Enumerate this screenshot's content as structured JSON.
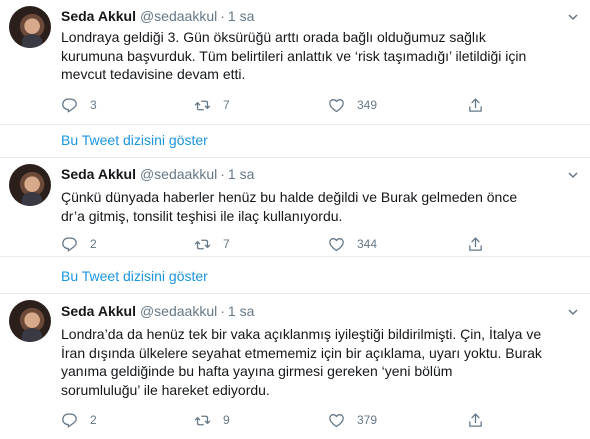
{
  "tweets": [
    {
      "name": "Seda Akkul",
      "handle": "@sedaakkul",
      "separator": "·",
      "time": "1 sa",
      "text": "Londraya geldiği 3. Gün öksürüğü arttı orada bağlı olduğumuz sağlık\nkurumuna başvurduk. Tüm belirtileri anlattık ve ‘risk taşımadığı’  iletildiği için\nmevcut tedavisine devam etti.",
      "replies": "3",
      "retweets": "7",
      "likes": "349",
      "thread_link": "Bu Tweet dizisini göster"
    },
    {
      "name": "Seda Akkul",
      "handle": "@sedaakkul",
      "separator": "·",
      "time": "1 sa",
      "text": "Çünkü dünyada haberler henüz bu halde değildi ve Burak gelmeden önce\ndr’a gitmiş, tonsilit teşhisi ile ilaç kullanıyordu.",
      "replies": "2",
      "retweets": "7",
      "likes": "344",
      "thread_link": "Bu Tweet dizisini göster"
    },
    {
      "name": "Seda Akkul",
      "handle": "@sedaakkul",
      "separator": "·",
      "time": "1 sa",
      "text": "Londra’da da henüz tek bir vaka açıklanmış iyileştiği bildirilmişti. Çin, İtalya ve\nİran dışında ülkelere seyahat etmememiz için bir açıklama, uyarı yoktu. Burak\nyanıma geldiğinde bu hafta yayına girmesi gereken ‘yeni bölüm\nsorumluluğu’ ile hareket ediyordu.",
      "replies": "2",
      "retweets": "9",
      "likes": "379"
    }
  ],
  "icons": {
    "reply": "reply-icon",
    "retweet": "retweet-icon",
    "like": "heart-icon",
    "share": "share-icon",
    "more": "chevron-down-icon"
  },
  "colors": {
    "link": "#1b95e0",
    "secondary_text": "#657786",
    "divider": "#e6ecf0"
  }
}
